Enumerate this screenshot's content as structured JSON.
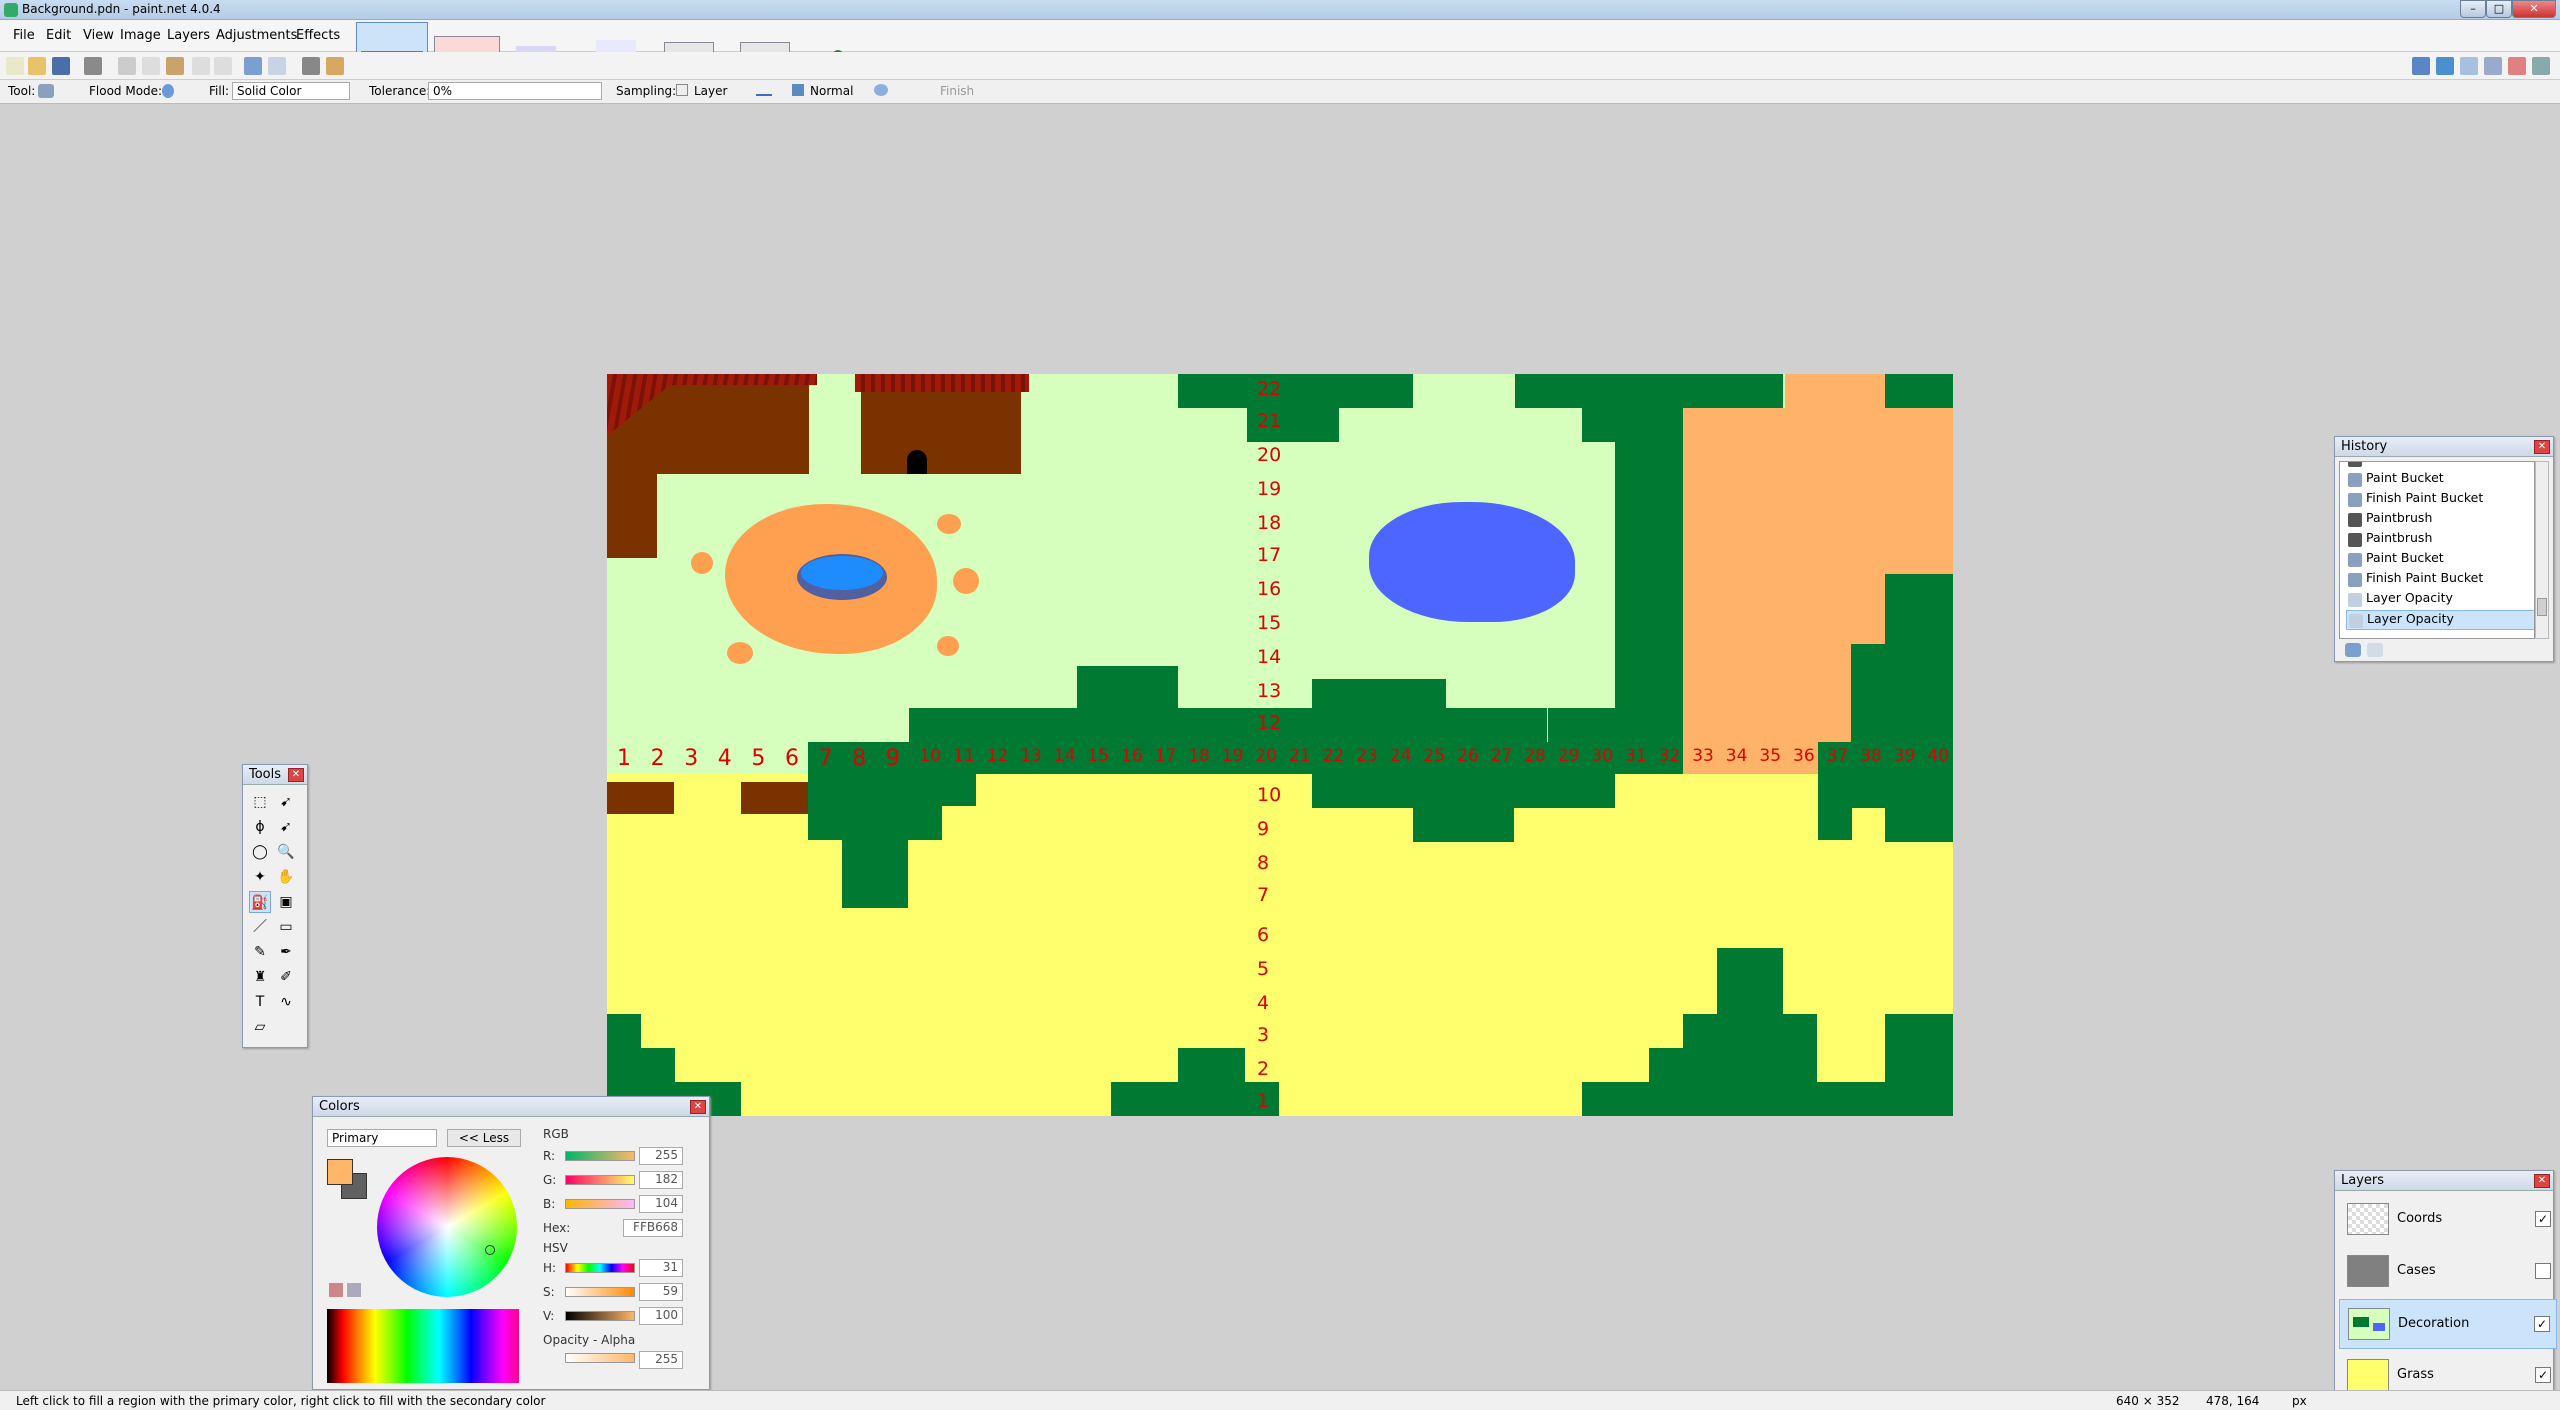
{
  "window": {
    "title": "Background.pdn - paint.net 4.0.4"
  },
  "menu": [
    "File",
    "Edit",
    "View",
    "Image",
    "Layers",
    "Adjustments",
    "Effects"
  ],
  "tool_options": {
    "tool_label": "Tool:",
    "flood_mode_label": "Flood Mode:",
    "fill_label": "Fill:",
    "fill_value": "Solid Color",
    "tolerance_label": "Tolerance:",
    "tolerance_value": "0%",
    "sampling_label": "Sampling:",
    "sampling_value": "Layer",
    "blend_value": "Normal",
    "finish_label": "Finish"
  },
  "canvas_numbers": {
    "bottom_axis": [
      "1",
      "2",
      "3",
      "4",
      "5",
      "6",
      "7",
      "8",
      "9",
      "10",
      "11",
      "12",
      "13",
      "14",
      "15",
      "16",
      "17",
      "18",
      "19",
      "20",
      "21",
      "22",
      "23",
      "24",
      "25",
      "26",
      "27",
      "28",
      "29",
      "30",
      "31",
      "32",
      "33",
      "34",
      "35",
      "36",
      "37",
      "38",
      "39",
      "40"
    ],
    "vertical_axis": [
      "22",
      "21",
      "20",
      "19",
      "18",
      "17",
      "16",
      "15",
      "14",
      "13",
      "12",
      "10",
      "9",
      "8",
      "7",
      "6",
      "5",
      "4",
      "3",
      "2",
      "1"
    ]
  },
  "tools_panel": {
    "title": "Tools"
  },
  "history_panel": {
    "title": "History",
    "items": [
      "Paintbrush",
      "Paint Bucket",
      "Finish Paint Bucket",
      "Paintbrush",
      "Paintbrush",
      "Paint Bucket",
      "Finish Paint Bucket",
      "Layer Opacity",
      "Layer Opacity"
    ]
  },
  "layers_panel": {
    "title": "Layers",
    "layers": [
      {
        "name": "Coords",
        "visible": true
      },
      {
        "name": "Cases",
        "visible": false
      },
      {
        "name": "Decoration",
        "visible": true
      },
      {
        "name": "Grass",
        "visible": true
      }
    ]
  },
  "colors_panel": {
    "title": "Colors",
    "mode": "Primary",
    "less_button": "<< Less",
    "rgb_label": "RGB",
    "r_label": "R:",
    "r": "255",
    "g_label": "G:",
    "g": "182",
    "b_label": "B:",
    "b": "104",
    "hex_label": "Hex:",
    "hex": "FFB668",
    "hsv_label": "HSV",
    "h_label": "H:",
    "h": "31",
    "s_label": "S:",
    "s": "59",
    "v_label": "V:",
    "v": "100",
    "opacity_label": "Opacity - Alpha",
    "alpha": "255",
    "primary_color": "#ffb668",
    "secondary_color": "#606060"
  },
  "status": {
    "hint": "Left click to fill a region with the primary color, right click to fill with the secondary color",
    "image_size": "640 × 352",
    "cursor": "478, 164",
    "units": "px"
  }
}
